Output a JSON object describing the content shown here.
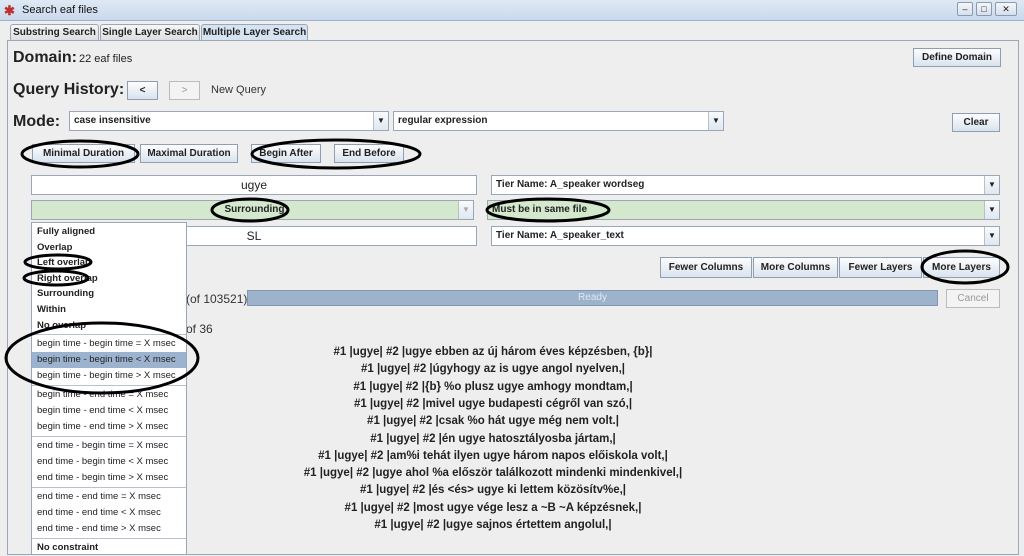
{
  "window": {
    "title": "Search eaf files",
    "controls": [
      "minimize",
      "maximize",
      "close"
    ]
  },
  "tabs": [
    {
      "label": "Substring Search"
    },
    {
      "label": "Single Layer Search"
    },
    {
      "label": "Multiple Layer Search",
      "selected": true
    }
  ],
  "domain": {
    "label": "Domain:",
    "value": "22 eaf files",
    "button": "Define Domain"
  },
  "history": {
    "label": "Query History:",
    "prev": "<",
    "next": ">",
    "status": "New Query"
  },
  "mode": {
    "label": "Mode:",
    "case": "case insensitive",
    "type": "regular expression",
    "clear": "Clear"
  },
  "constraint_buttons": [
    "Minimal Duration",
    "Maximal Duration",
    "Begin After",
    "End Before"
  ],
  "layers": {
    "query1": "ugye",
    "tier1": "Tier Name: A_speaker wordseg",
    "relation": "Surrounding",
    "file_constraint": "Must be in same file",
    "query2": "SL",
    "tier2": "Tier Name: A_speaker_text"
  },
  "layout_buttons": [
    "Fewer Columns",
    "More Columns",
    "Fewer Layers",
    "More Layers"
  ],
  "progress": {
    "count_text": "(of 103521)",
    "status": "Ready",
    "percent": 100,
    "cancel": "Cancel"
  },
  "results_page": "of 36",
  "dropdown": {
    "groups": [
      [
        "Fully aligned",
        "Overlap",
        "Left overlap",
        "Right overlap",
        "Surrounding",
        "Within",
        "No overlap"
      ],
      [
        "begin time - begin time = X msec",
        "begin time - begin time < X msec",
        "begin time - begin time > X msec"
      ],
      [
        "begin time - end time = X msec",
        "begin time - end time < X msec",
        "begin time - end time > X msec"
      ],
      [
        "end time - begin time = X msec",
        "end time - begin time < X msec",
        "end time - begin time > X msec"
      ],
      [
        "end time - end time = X msec",
        "end time - end time < X msec",
        "end time - end time > X msec"
      ],
      [
        "No constraint"
      ]
    ],
    "selected": "begin time - begin time < X msec"
  },
  "results": [
    "#1 |ugye|  #2 |ugye ebben az új három éves képzésben, {b}|",
    "#1 |ugye|  #2 |úgyhogy az is ugye angol nyelven,|",
    "#1 |ugye|  #2 |{b} %o plusz ugye amhogy mondtam,|",
    "#1 |ugye|  #2 |mivel ugye budapesti cégről van szó,|",
    "#1 |ugye|  #2 |csak %o hát ugye még nem volt.|",
    "#1 |ugye|  #2 |én ugye hatosztályosba jártam,|",
    "#1 |ugye|  #2 |am%i tehát ilyen ugye három napos előiskola volt,|",
    "#1 |ugye|  #2 |ugye ahol %a először találkozott mindenki mindenkivel,|",
    "#1 |ugye|  #2 |és <és> ugye ki lettem közösítv%e,|",
    "#1 |ugye|  #2 |most ugye vége lesz a ~B ~A képzésnek,|",
    "#1 |ugye|  #2 |ugye sajnos értettem angolul,|"
  ],
  "colors": {
    "match_green": "#d3e8cc",
    "selected_item": "#9cb3cf",
    "progress": "#9db3cc",
    "annotation": "#000000"
  }
}
